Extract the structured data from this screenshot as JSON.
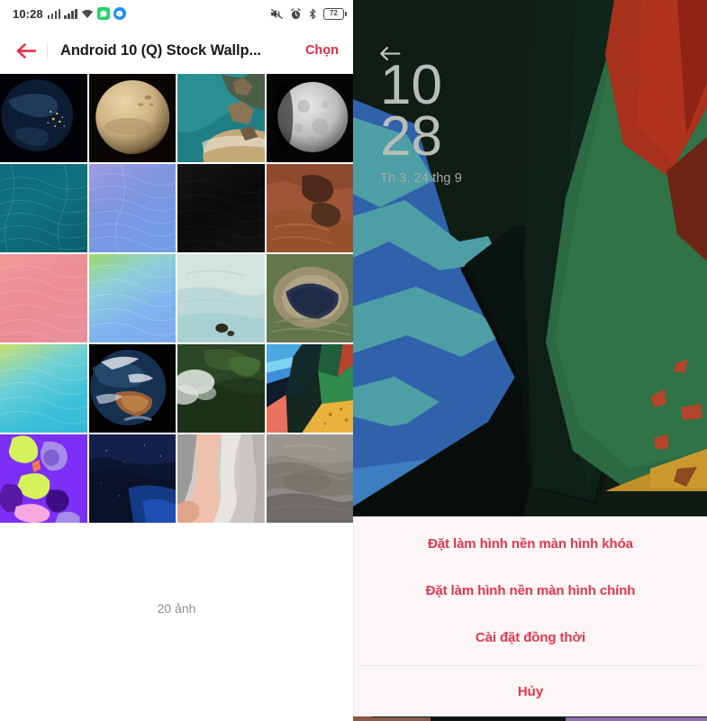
{
  "status_bar": {
    "time": "10:28",
    "battery_level": "72",
    "icons_left": [
      "signal-bars-sim1",
      "signal-bars-sim2",
      "wifi-icon",
      "whatsapp-icon",
      "messenger-icon"
    ],
    "icons_right": [
      "mute-icon",
      "alarm-icon",
      "bluetooth-icon",
      "battery-icon"
    ]
  },
  "app_bar": {
    "back_icon": "back-arrow-icon",
    "title": "Android 10 (Q) Stock Wallp...",
    "action_label": "Chọn",
    "accent_color": "#e8263f"
  },
  "gallery": {
    "photo_count_label": "20 ảnh",
    "columns": 4,
    "thumbnails": [
      {
        "name": "earth-night-lights",
        "desc": "Earth at night with city lights"
      },
      {
        "name": "mars-planet",
        "desc": "Mars planet tan surface"
      },
      {
        "name": "coastline-aerial",
        "desc": "Turquoise coastline aerial view"
      },
      {
        "name": "moon-gray",
        "desc": "Gray moon on black"
      },
      {
        "name": "teal-swirl",
        "desc": "Teal flowing swirl gradient"
      },
      {
        "name": "blue-violet-swirl",
        "desc": "Blue violet flowing swirl"
      },
      {
        "name": "black-swirl",
        "desc": "Black dark flowing swirl"
      },
      {
        "name": "red-desert-canyon",
        "desc": "Red desert canyon aerial"
      },
      {
        "name": "coral-swirl",
        "desc": "Coral pink flowing swirl"
      },
      {
        "name": "blue-yellow-swirl",
        "desc": "Blue and yellow flowing swirl"
      },
      {
        "name": "pale-lagoon",
        "desc": "Pale turquoise lagoon aerial"
      },
      {
        "name": "crater-lake",
        "desc": "Crater lake aerial view"
      },
      {
        "name": "cyan-yellow-swirl",
        "desc": "Cyan and yellow flowing swirl"
      },
      {
        "name": "earth-from-space",
        "desc": "Earth from space with clouds"
      },
      {
        "name": "forest-clouds",
        "desc": "Dark forest with low clouds"
      },
      {
        "name": "geometric-landscape",
        "desc": "Flat geometric landscape blue green"
      },
      {
        "name": "purple-blobs",
        "desc": "Purple abstract blob shapes"
      },
      {
        "name": "deep-blue-night",
        "desc": "Deep blue night satellite view"
      },
      {
        "name": "pink-beige-shapes",
        "desc": "Pink and beige organic shapes"
      },
      {
        "name": "gray-terrain",
        "desc": "Gray brown aerial terrain"
      }
    ]
  },
  "preview": {
    "back_icon": "back-arrow-icon",
    "clock_hours": "10",
    "clock_minutes": "28",
    "date": "Th 3, 24 thg 9",
    "wallpaper_name": "geometric-landscape-wallpaper"
  },
  "action_sheet": {
    "options": [
      {
        "name": "set-lock-screen-wallpaper",
        "label": "Đặt làm hình nền màn hình khóa"
      },
      {
        "name": "set-home-screen-wallpaper",
        "label": "Đặt làm hình nền màn hình chính"
      },
      {
        "name": "set-both-wallpaper",
        "label": "Cài đặt đồng thời"
      }
    ],
    "cancel_label": "Hủy",
    "accent_color": "#e0374f"
  }
}
